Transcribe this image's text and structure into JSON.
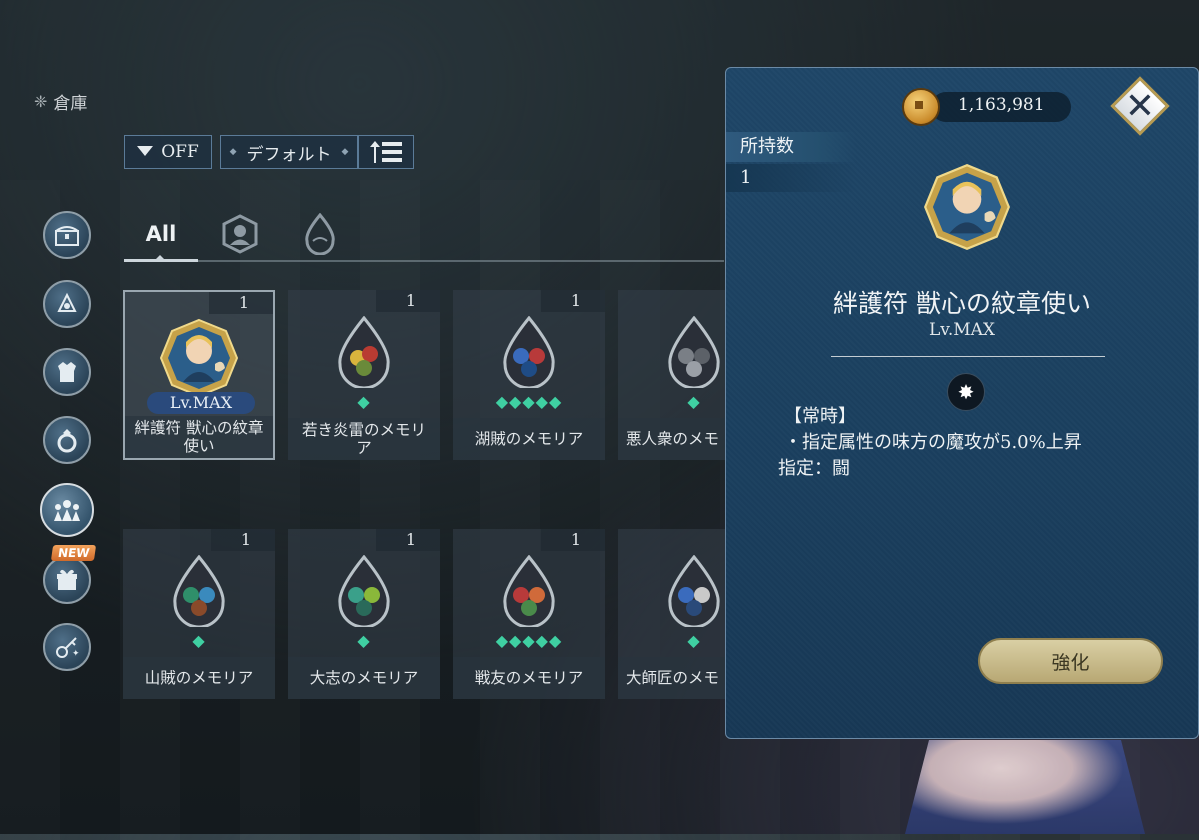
{
  "header": {
    "title": "倉庫"
  },
  "filter": {
    "filter_state": "OFF",
    "sort_label": "デフォルト"
  },
  "tabs": {
    "all_label": "All"
  },
  "sidebar": {
    "new_badge": "NEW"
  },
  "items": [
    {
      "count": "1",
      "name": "絆護符 獣心の紋章使い",
      "level": "Lv.MAX",
      "stars": "",
      "kind": "charm"
    },
    {
      "count": "1",
      "name": "若き炎雷のメモリア",
      "stars": "◆",
      "kind": "memoria"
    },
    {
      "count": "1",
      "name": "湖賊のメモリア",
      "stars": "◆◆◆◆◆",
      "kind": "memoria"
    },
    {
      "count": "",
      "name": "悪人衆のメモ",
      "stars": "◆",
      "kind": "memoria"
    },
    {
      "count": "1",
      "name": "山賊のメモリア",
      "stars": "◆",
      "kind": "memoria"
    },
    {
      "count": "1",
      "name": "大志のメモリア",
      "stars": "◆",
      "kind": "memoria"
    },
    {
      "count": "1",
      "name": "戦友のメモリア",
      "stars": "◆◆◆◆◆",
      "kind": "memoria"
    },
    {
      "count": "",
      "name": "大師匠のメモ",
      "stars": "◆",
      "kind": "memoria"
    }
  ],
  "detail": {
    "currency": "1,163,981",
    "owned_label": "所持数",
    "owned_value": "1",
    "name": "絆護符 獣心の紋章使い",
    "level": "Lv.MAX",
    "effect_heading": "【常時】",
    "effect_line": "・指定属性の味方の魔攻が5.0%上昇",
    "target": "指定：闘",
    "enhance_label": "強化"
  }
}
